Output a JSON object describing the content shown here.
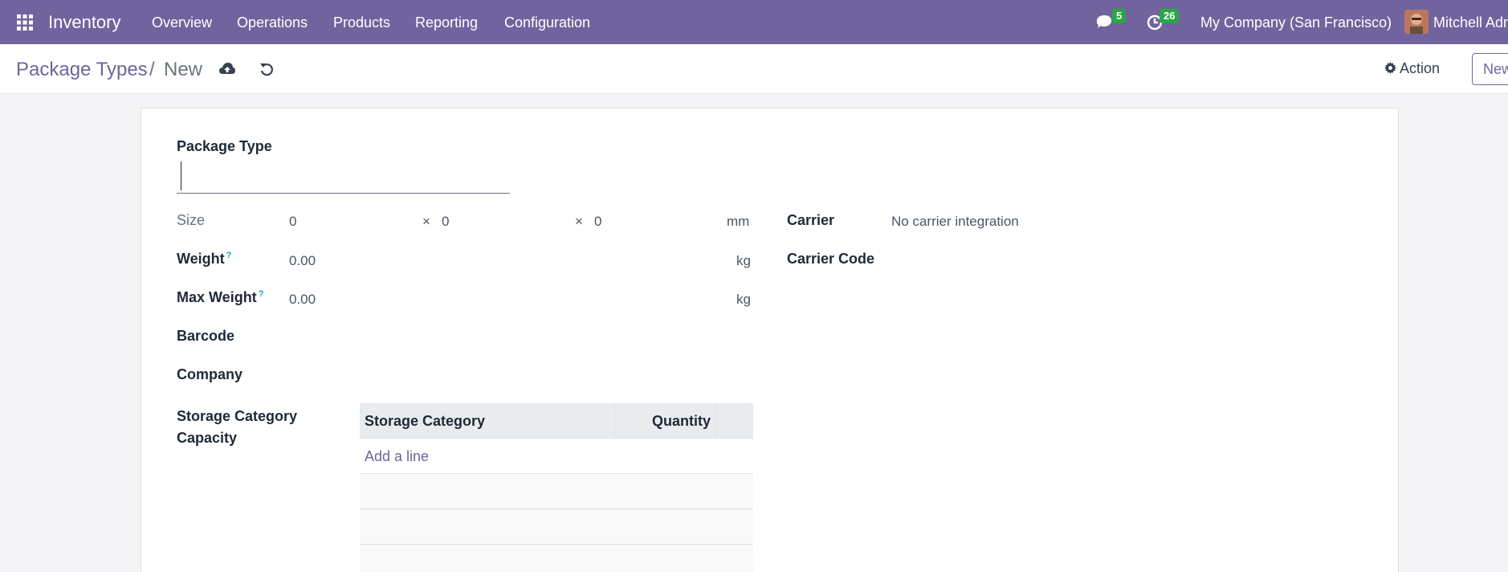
{
  "navbar": {
    "app_name": "Inventory",
    "menus": [
      "Overview",
      "Operations",
      "Products",
      "Reporting",
      "Configuration"
    ],
    "messages_count": "5",
    "activities_count": "26",
    "company": "My Company (San Francisco)",
    "user": "Mitchell Admin",
    "color": "#71639e"
  },
  "control_panel": {
    "breadcrumb_parent": "Package Types",
    "breadcrumb_separator": "/",
    "breadcrumb_current": "New",
    "action_label": "Action",
    "new_label": "New"
  },
  "form": {
    "package_type_label": "Package Type",
    "package_type_value": "",
    "size_label": "Size",
    "length": "0",
    "width": "0",
    "height": "0",
    "times": "×",
    "size_unit": "mm",
    "weight_label": "Weight",
    "weight_value": "0.00",
    "weight_unit": "kg",
    "max_weight_label": "Max Weight",
    "max_weight_value": "0.00",
    "max_weight_unit": "kg",
    "help_mark": "?",
    "barcode_label": "Barcode",
    "company_label": "Company",
    "storage_label_line1": "Storage Category",
    "storage_label_line2": "Capacity",
    "carrier_label": "Carrier",
    "carrier_value": "No carrier integration",
    "carrier_code_label": "Carrier Code",
    "table": {
      "columns": [
        "Storage Category",
        "Quantity"
      ],
      "add_line": "Add a line"
    }
  }
}
